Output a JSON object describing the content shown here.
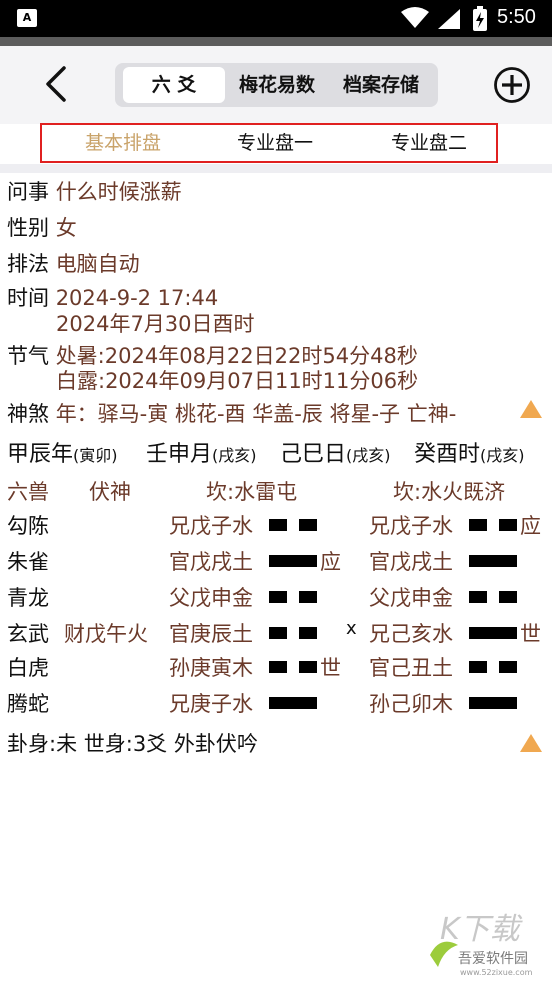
{
  "status_bar": {
    "time": "5:50"
  },
  "header": {
    "tabs": [
      {
        "label": "六 爻",
        "active": true
      },
      {
        "label": "梅花易数",
        "active": false
      },
      {
        "label": "档案存储",
        "active": false
      }
    ]
  },
  "subtabs": [
    {
      "label": "基本排盘",
      "active": true
    },
    {
      "label": "专业盘一",
      "active": false
    },
    {
      "label": "专业盘二",
      "active": false
    }
  ],
  "info": {
    "question_label": "问事",
    "question_value": "什么时候涨薪",
    "gender_label": "性别",
    "gender_value": "女",
    "method_label": "排法",
    "method_value": "电脑自动",
    "time_label": "时间",
    "time_value1": "2024-9-2 17:44",
    "time_value2": "2024年7月30日酉时",
    "solar_label": "节气",
    "solar_value1": "处暑:2024年08月22日22时54分48秒",
    "solar_value2": "白露:2024年09月07日11时11分06秒",
    "spirits_label": "神煞",
    "spirits_value": "年：驿马-寅 桃花-酉 华盖-辰 将星-子 亡神-"
  },
  "pillars": [
    {
      "main": "甲辰年",
      "void": "(寅卯)"
    },
    {
      "main": "壬申月",
      "void": "(戌亥)"
    },
    {
      "main": "己巳日",
      "void": "(戌亥)"
    },
    {
      "main": "癸酉时",
      "void": "(戌亥)"
    }
  ],
  "table": {
    "col_beasts": "六兽",
    "col_hidden": "伏神",
    "col_main": "坎:水雷屯",
    "col_changed": "坎:水火既济",
    "beasts": [
      "勾陈",
      "朱雀",
      "青龙",
      "玄武",
      "白虎",
      "腾蛇"
    ],
    "hidden": [
      "",
      "",
      "",
      "财戊午火",
      "",
      ""
    ],
    "main_lines": [
      "兄戊子水",
      "官戊戌土",
      "父戊申金",
      "官庚辰土",
      "孙庚寅木",
      "兄庚子水"
    ],
    "main_yang": [
      false,
      true,
      false,
      false,
      false,
      true
    ],
    "main_mark": [
      "",
      "应",
      "",
      "",
      "世",
      ""
    ],
    "moving": [
      "",
      "",
      "",
      "x",
      "",
      ""
    ],
    "changed_lines": [
      "兄戊子水",
      "官戊戌土",
      "父戊申金",
      "兄己亥水",
      "官己丑土",
      "孙己卯木"
    ],
    "changed_yang": [
      false,
      true,
      false,
      true,
      false,
      true
    ],
    "changed_mark": [
      "应",
      "",
      "",
      "世",
      "",
      ""
    ]
  },
  "footer": {
    "summary": "卦身:未 世身:3爻 外卦伏吟"
  },
  "watermark": {
    "text": "吾爱软件园",
    "url": "www.52zixue.com"
  }
}
